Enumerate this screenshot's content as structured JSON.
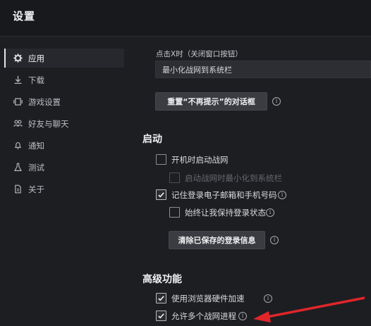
{
  "window": {
    "title": "设置"
  },
  "sidebar": {
    "items": [
      {
        "label": "应用",
        "icon": "gear-icon",
        "active": true
      },
      {
        "label": "下载",
        "icon": "download-icon"
      },
      {
        "label": "游戏设置",
        "icon": "game-settings-icon"
      },
      {
        "label": "好友与聊天",
        "icon": "friends-icon"
      },
      {
        "label": "通知",
        "icon": "bell-icon"
      },
      {
        "label": "测试",
        "icon": "flask-icon"
      },
      {
        "label": "关于",
        "icon": "document-icon"
      }
    ]
  },
  "main": {
    "close_label": "点击X时（关闭窗口按钮）",
    "close_select_value": "最小化战网到系统栏",
    "reset_dialogs_button": "重置“不再提示”的对话框",
    "startup": {
      "heading": "启动",
      "launch_on_startup": "开机时启动战网",
      "minimize_on_startup": "启动战网时最小化到系统栏",
      "remember_email": "记住登录电子邮箱和手机号码",
      "keep_logged_in": "始终让我保持登录状态",
      "clear_login_button": "清除已保存的登录信息"
    },
    "advanced": {
      "heading": "高级功能",
      "hardware_acceleration": "使用浏览器硬件加速",
      "allow_multiple": "允许多个战网进程"
    }
  },
  "colors": {
    "background": "#1d1e22",
    "titlebar": "#18191c",
    "arrow": "#e0262b"
  }
}
